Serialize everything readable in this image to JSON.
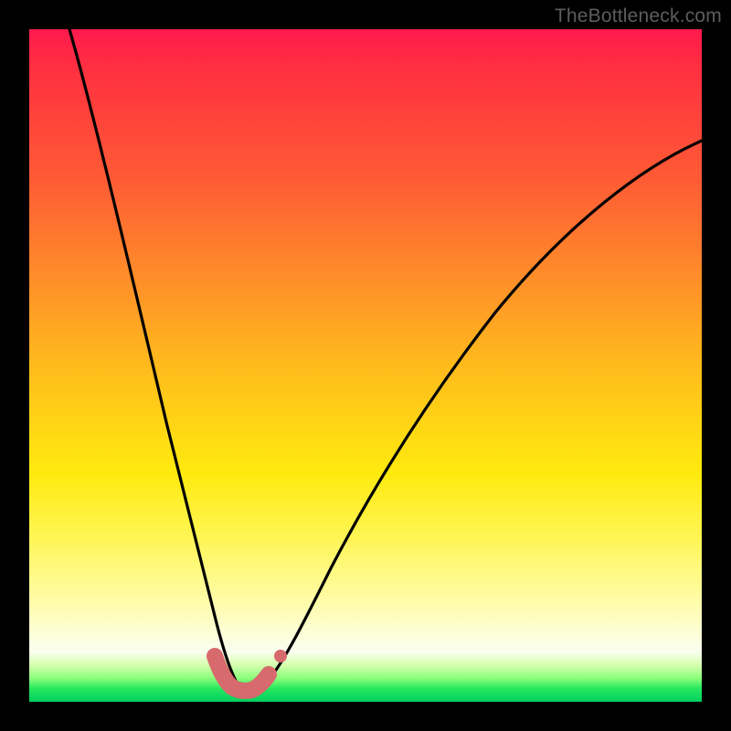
{
  "watermark": "TheBottleneck.com",
  "colors": {
    "frame": "#000000",
    "curve": "#000000",
    "marker": "#d76a6d",
    "gradient_top": "#ff1a4d",
    "gradient_bottom": "#00d060"
  },
  "chart_data": {
    "type": "line",
    "title": "",
    "xlabel": "",
    "ylabel": "",
    "xlim": [
      0,
      100
    ],
    "ylim": [
      0,
      100
    ],
    "grid": false,
    "legend": false,
    "note": "Axes are unlabeled in the source image; x/y are normalized 0–100 left→right / bottom→top. Curve is a V-shaped bottleneck profile with minimum near x≈31; pink markers sit along the trough.",
    "series": [
      {
        "name": "bottleneck-curve",
        "color": "#000000",
        "x": [
          6,
          10,
          14,
          18,
          22,
          25,
          27,
          29,
          30.5,
          32,
          33.5,
          35,
          38,
          42,
          48,
          56,
          66,
          78,
          92,
          100
        ],
        "y": [
          100,
          84,
          66,
          48,
          31,
          18,
          10,
          4,
          1,
          0.5,
          1,
          3,
          9,
          18,
          30,
          43,
          56,
          67,
          76,
          80
        ]
      },
      {
        "name": "trough-markers",
        "type": "scatter",
        "color": "#d76a6d",
        "x": [
          27.5,
          29,
          30.5,
          32,
          33.5,
          35,
          37
        ],
        "y": [
          5,
          2,
          0.8,
          0.5,
          0.8,
          2,
          6
        ]
      }
    ]
  }
}
